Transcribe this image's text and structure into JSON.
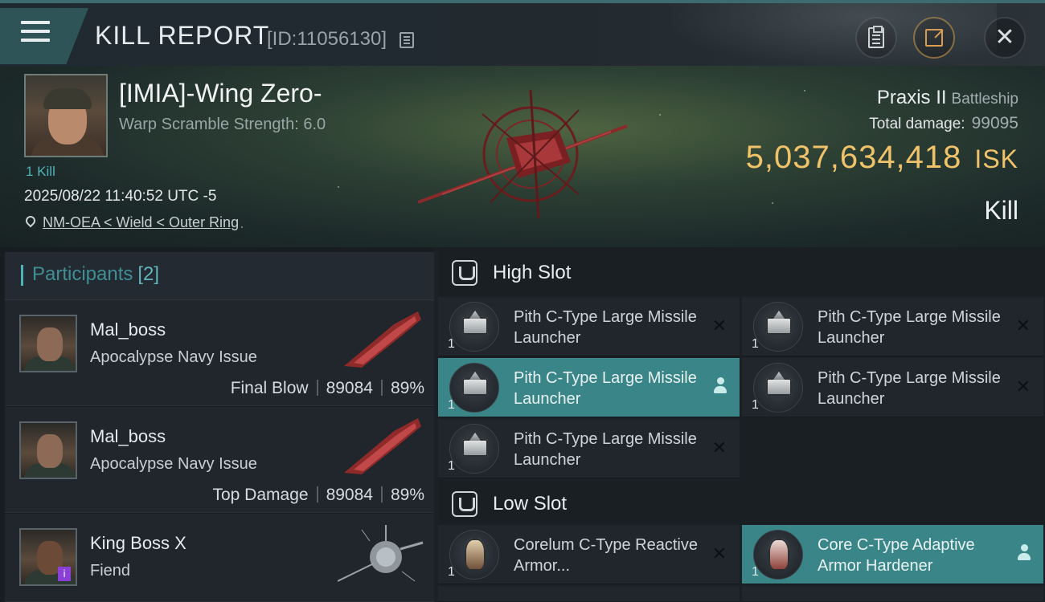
{
  "header": {
    "title": "KILL REPORT",
    "report_id": "[ID:11056130]"
  },
  "victim": {
    "name": "[IMIA]-Wing Zero-",
    "warp_scramble": "Warp Scramble Strength: 6.0",
    "kill_count": "1 Kill",
    "datetime": "2025/08/22 11:40:52 UTC -5",
    "location": "NM-OEA < Wield < Outer Ring",
    "ship_name": "Praxis II",
    "ship_class": "Battleship",
    "total_damage_label": "Total damage:",
    "total_damage": "99095",
    "isk_value": "5,037,634,418",
    "isk_unit": "ISK",
    "result": "Kill"
  },
  "participants": {
    "title": "Participants",
    "count": "[2]",
    "rows": [
      {
        "name": "Mal_boss",
        "ship": "Apocalypse Navy Issue",
        "role": "Final Blow",
        "damage": "89084",
        "percent": "89%"
      },
      {
        "name": "Mal_boss",
        "ship": "Apocalypse Navy Issue",
        "role": "Top Damage",
        "damage": "89084",
        "percent": "89%"
      },
      {
        "name": "King Boss X",
        "ship": "Fiend",
        "badge": "i"
      }
    ]
  },
  "fitting": {
    "high_slot": {
      "title": "High Slot",
      "modules": [
        {
          "qty": "1",
          "name": "Pith C-Type Large Missile Launcher",
          "status": "destroyed"
        },
        {
          "qty": "1",
          "name": "Pith C-Type Large Missile Launcher",
          "status": "destroyed"
        },
        {
          "qty": "1",
          "name": "Pith C-Type Large Missile Launcher",
          "status": "dropped"
        },
        {
          "qty": "1",
          "name": "Pith C-Type Large Missile Launcher",
          "status": "destroyed"
        },
        {
          "qty": "1",
          "name": "Pith C-Type Large Missile Launcher",
          "status": "destroyed"
        }
      ]
    },
    "low_slot": {
      "title": "Low Slot",
      "modules": [
        {
          "qty": "1",
          "name": "Corelum C-Type Reactive Armor...",
          "status": "destroyed"
        },
        {
          "qty": "1",
          "name": "Core C-Type Adaptive Armor Hardener",
          "status": "dropped"
        }
      ]
    }
  },
  "colors": {
    "accent_teal": "#3a8587",
    "isk_gold": "#f0c36a",
    "header_bg": "#1f2a30"
  }
}
